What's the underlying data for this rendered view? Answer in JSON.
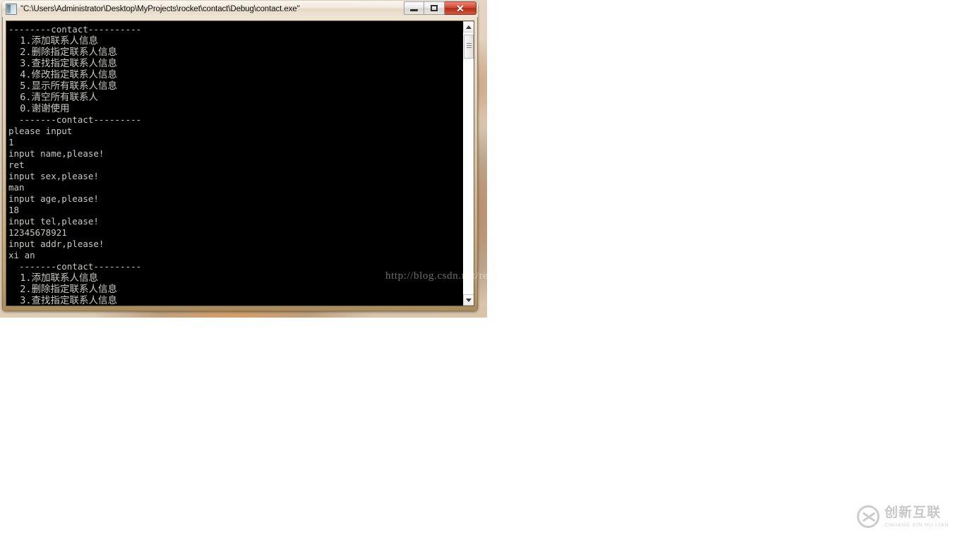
{
  "desktop": {
    "background_color": "#ffffff"
  },
  "window": {
    "title": "\"C:\\Users\\Administrator\\Desktop\\MyProjects\\rocket\\contact\\Debug\\contact.exe\"",
    "icon": "console-window-icon",
    "controls": {
      "minimize_label": "–",
      "maximize_label": "□",
      "close_label": "✕"
    },
    "frame_color": "#cbb189",
    "titlebar_color": "#efe5d5"
  },
  "console": {
    "background_color": "#000000",
    "text_color": "#c8c8c0",
    "lines": [
      {
        "text": "--------contact----------",
        "cjk": false
      },
      {
        "text": "  1.添加联系人信息",
        "cjk": true
      },
      {
        "text": "  2.删除指定联系人信息",
        "cjk": true
      },
      {
        "text": "  3.查找指定联系人信息",
        "cjk": true
      },
      {
        "text": "  4.修改指定联系人信息",
        "cjk": true
      },
      {
        "text": "  5.显示所有联系人信息",
        "cjk": true
      },
      {
        "text": "  6.清空所有联系人",
        "cjk": true
      },
      {
        "text": "  0.谢谢使用",
        "cjk": true
      },
      {
        "text": "  -------contact---------",
        "cjk": false
      },
      {
        "text": "please input",
        "cjk": false
      },
      {
        "text": "1",
        "cjk": false
      },
      {
        "text": "input name,please!",
        "cjk": false
      },
      {
        "text": "ret",
        "cjk": false
      },
      {
        "text": "input sex,please!",
        "cjk": false
      },
      {
        "text": "man",
        "cjk": false
      },
      {
        "text": "input age,please!",
        "cjk": false
      },
      {
        "text": "18",
        "cjk": false
      },
      {
        "text": "input tel,please!",
        "cjk": false
      },
      {
        "text": "12345678921",
        "cjk": false
      },
      {
        "text": "input addr,please!",
        "cjk": false
      },
      {
        "text": "xi an",
        "cjk": false
      },
      {
        "text": "  -------contact---------",
        "cjk": false
      },
      {
        "text": "  1.添加联系人信息",
        "cjk": true
      },
      {
        "text": "  2.删除指定联系人信息",
        "cjk": true
      },
      {
        "text": "  3.查找指定联系人信息",
        "cjk": true
      }
    ],
    "scrollbar": {
      "up_arrow": "▲",
      "down_arrow": "▼"
    }
  },
  "watermark": {
    "text": "http://blog.csdn.net/ret_skd"
  },
  "brand": {
    "name_cn": "创新互联",
    "name_pinyin": "CHUANG XIN HU LIAN"
  }
}
